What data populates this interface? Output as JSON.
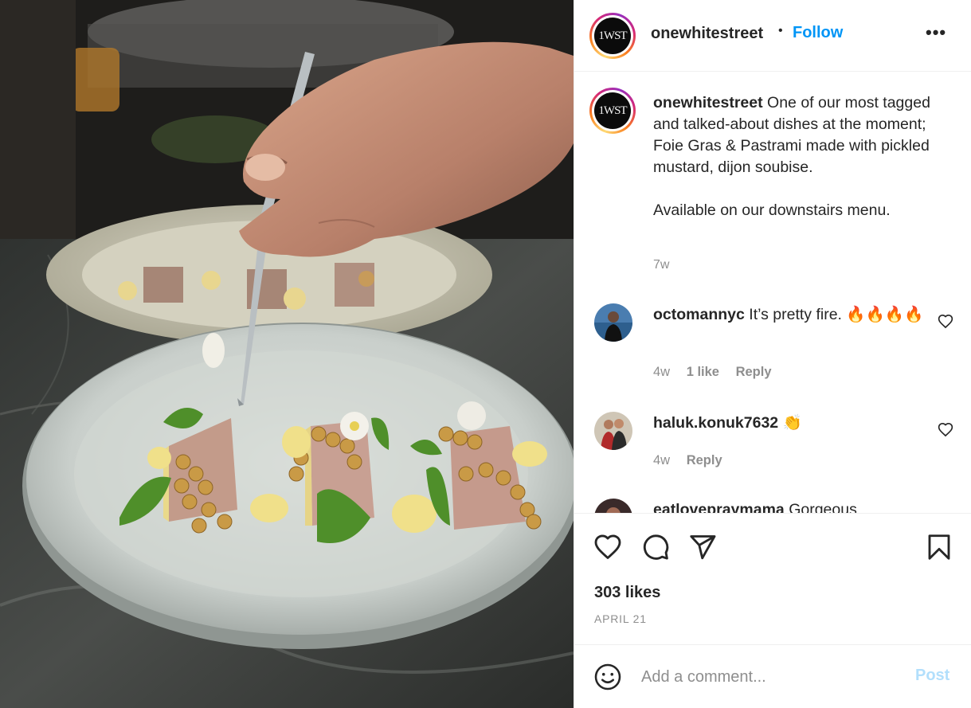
{
  "post": {
    "username": "onewhitestreet",
    "follow_label": "Follow",
    "separator": "•",
    "more_label": "•••",
    "avatar_initials": "1WST"
  },
  "caption": {
    "username": "onewhitestreet",
    "text": "One of our most tagged and talked-about dishes at the moment; Foie Gras & Pastrami made with pickled mustard, dijon soubise.",
    "text2": "Available on our downstairs menu.",
    "time": "7w"
  },
  "comments": [
    {
      "username": "octomannyc",
      "text": "It’s pretty fire. 🔥🔥🔥🔥",
      "time": "4w",
      "likes": "1 like",
      "reply": "Reply"
    },
    {
      "username": "haluk.konuk7632",
      "text": "👏",
      "time": "4w",
      "reply": "Reply"
    },
    {
      "username": "eatlovepraymama",
      "text": "Gorgeous"
    }
  ],
  "actions": {
    "like_icon": "heart-icon",
    "comment_icon": "comment-icon",
    "share_icon": "paper-plane-icon",
    "save_icon": "bookmark-icon"
  },
  "likes": "303 likes",
  "date": "APRIL 21",
  "comment_box": {
    "placeholder": "Add a comment...",
    "post_label": "Post"
  },
  "colors": {
    "accent": "#0095f6",
    "post_disabled": "#b2dffc",
    "muted": "#8e8e8e",
    "text": "#262626"
  }
}
